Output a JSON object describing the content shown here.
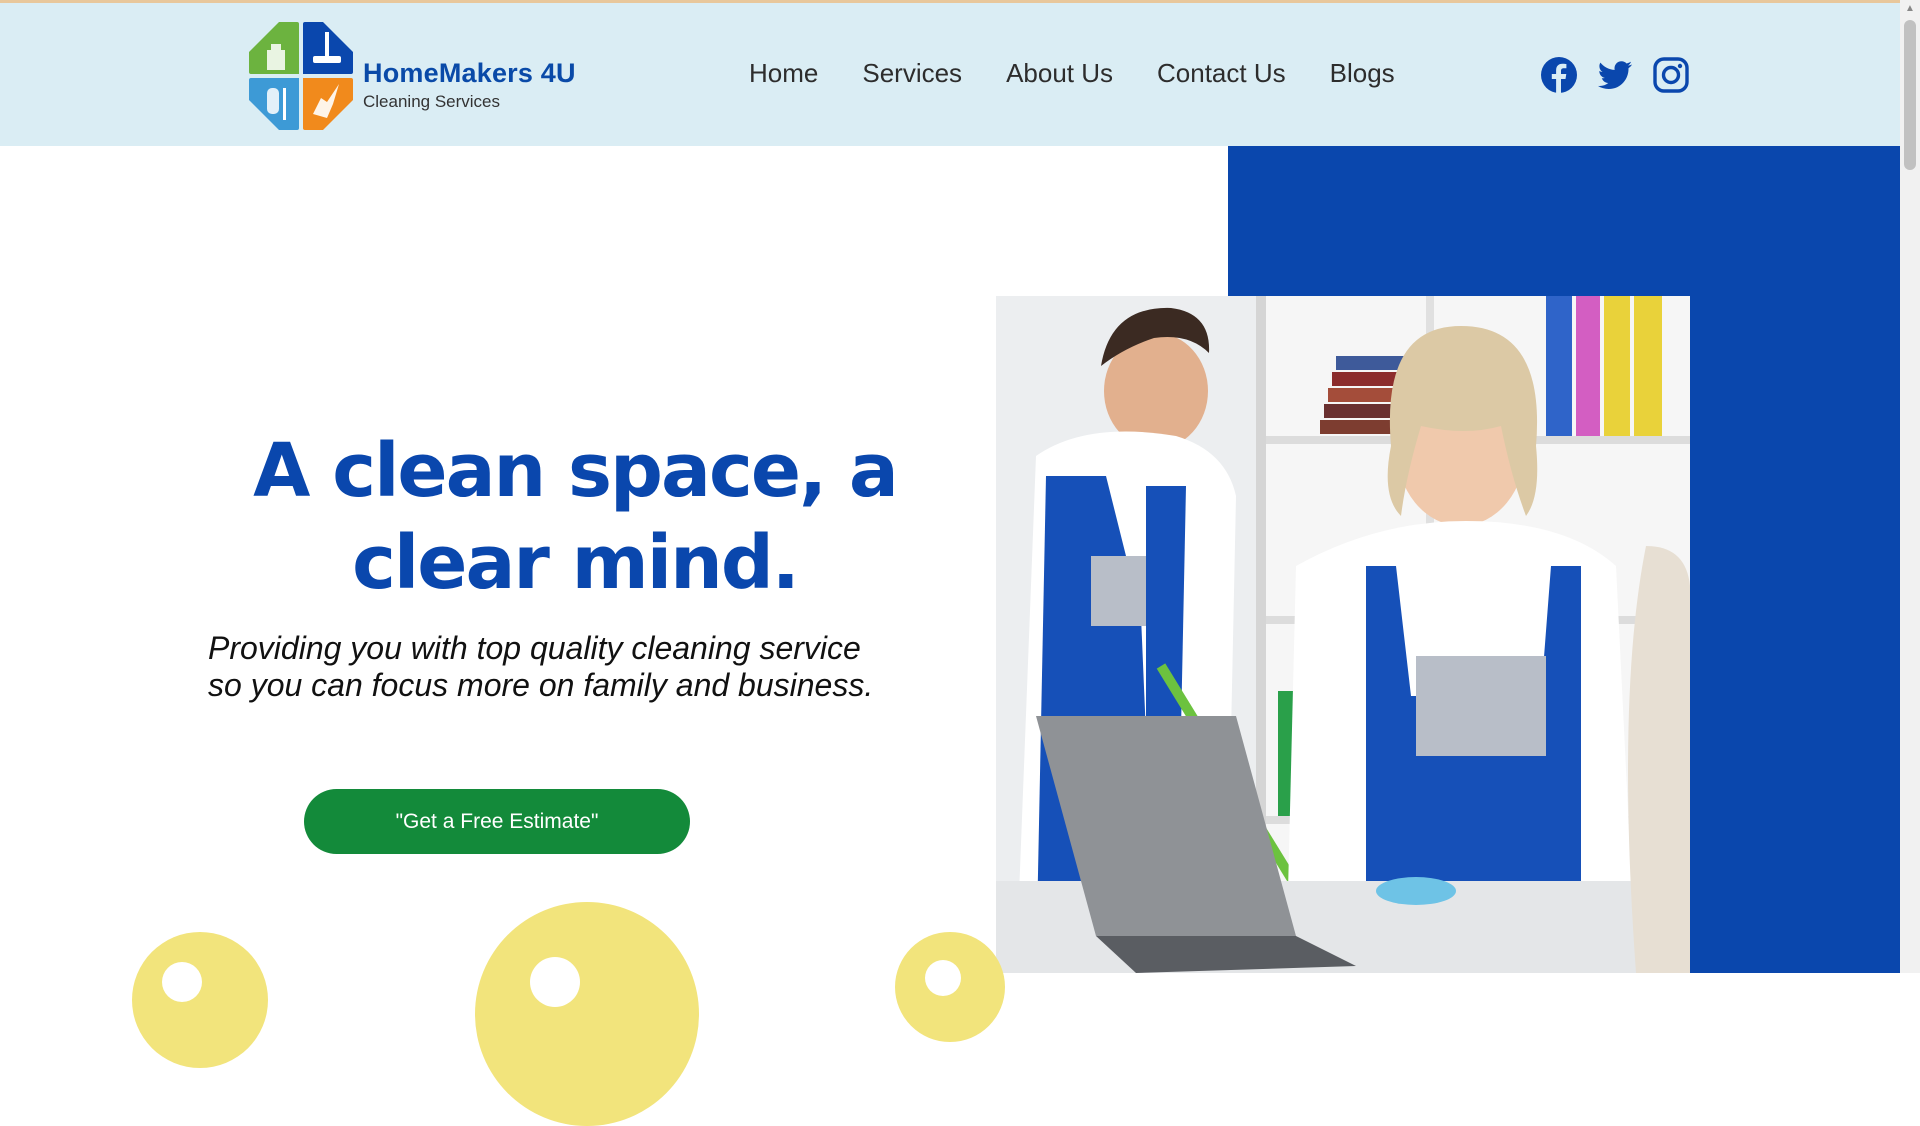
{
  "colors": {
    "header_bg": "#daedf4",
    "brand_blue": "#0a47ad",
    "cta_green": "#138a3a",
    "accent_yellow": "#f2e47c"
  },
  "logo": {
    "name": "HomeMakers 4U",
    "tagline": "Cleaning Services",
    "icons": [
      "spray-bottle-icon",
      "mop-icon",
      "vacuum-icon",
      "broom-icon"
    ]
  },
  "nav": {
    "items": [
      {
        "label": "Home"
      },
      {
        "label": "Services"
      },
      {
        "label": "About Us"
      },
      {
        "label": "Contact Us"
      },
      {
        "label": "Blogs"
      }
    ]
  },
  "social": {
    "icons": [
      "facebook-icon",
      "twitter-icon",
      "instagram-icon"
    ]
  },
  "hero": {
    "headline_line1": "A clean space, a",
    "headline_line2": "clear mind.",
    "subhead_line1": "Providing you with top quality cleaning service",
    "subhead_line2": "so you can focus more on family and business.",
    "cta_label": "\"Get a Free Estimate\""
  }
}
